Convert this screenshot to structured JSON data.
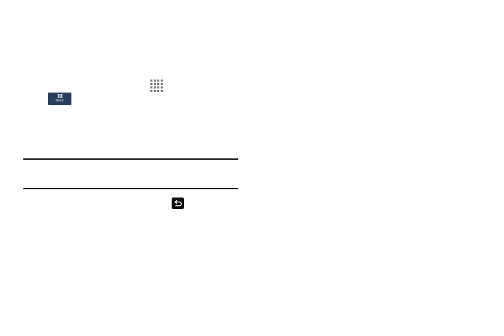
{
  "icons": {
    "apps": "apps-grid-icon",
    "more_grid": "grid-icon",
    "back": "back-key-icon"
  },
  "more_button": {
    "label": "More",
    "background": "#2b3f5c",
    "text_color": "#e8eef6"
  },
  "colors": {
    "page_background": "#ffffff",
    "rule": "#111111",
    "icon_gray": "#7a7a7a",
    "back_key_background": "#111111"
  }
}
